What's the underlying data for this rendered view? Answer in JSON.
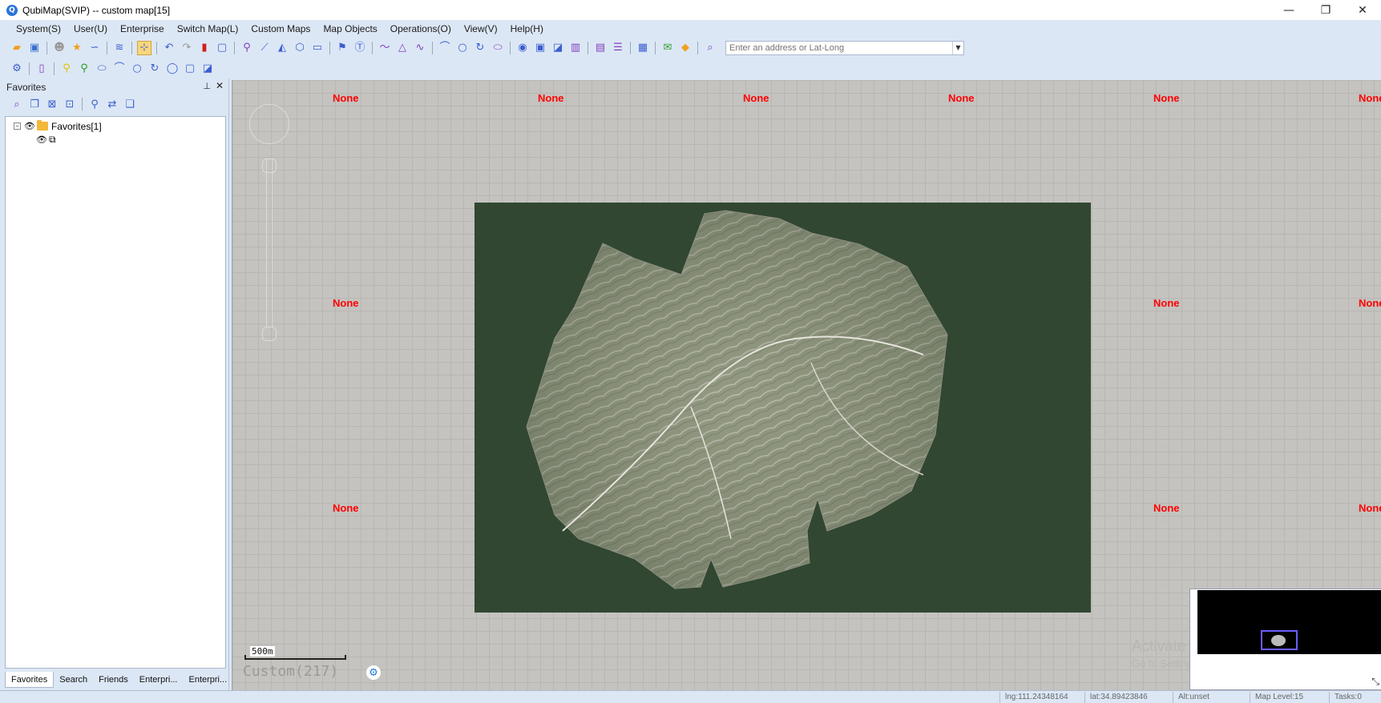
{
  "window": {
    "title": "QubiMap(SVIP) -- custom map[15]",
    "controls": {
      "minimize": "—",
      "restore": "❐",
      "close": "✕"
    }
  },
  "menu": [
    "System(S)",
    "User(U)",
    "Enterprise",
    "Switch Map(L)",
    "Custom Maps",
    "Map Objects",
    "Operations(O)",
    "View(V)",
    "Help(H)"
  ],
  "address": {
    "placeholder": "Enter an address or Lat-Long"
  },
  "left_panel": {
    "title": "Favorites",
    "tree": {
      "root_label": "Favorites[1]"
    },
    "tabs": [
      "Favorites",
      "Search",
      "Friends",
      "Enterpri...",
      "Enterpri..."
    ]
  },
  "map": {
    "tile_label": "None",
    "scale_label": "500m",
    "custom_label": "Custom(217)",
    "watermark": {
      "line1": "Activate Windows",
      "line2": "Go to Settings to activate Windows."
    }
  },
  "status": {
    "lng": "lng:111.24348164",
    "lat": "lat:34.89423846",
    "alt": "Alt:unset",
    "level": "Map Level:15",
    "tasks": "Tasks:0"
  },
  "colors": {
    "accent": "#2a74d8",
    "tile_label": "#ff0000",
    "raster_bg": "#314731",
    "panel_bg": "#dce7f5"
  },
  "icons": {
    "toolbar1": [
      "open-folder-icon",
      "save-icon",
      "user-icon",
      "favorite-star-icon",
      "link-icon",
      "layers-icon",
      "select-tool-icon",
      "undo-icon",
      "redo-icon",
      "delete-icon",
      "rect-select-icon",
      "marker-icon",
      "ruler-icon",
      "measure-area-icon",
      "polygon-tool-icon",
      "video-icon",
      "pin-icon",
      "text-icon",
      "polyline-icon",
      "triangle-icon",
      "curve-icon",
      "arc-icon",
      "circle-icon",
      "rotate-icon",
      "ellipse-icon",
      "circle-solid-icon",
      "square-icon",
      "shape-icon",
      "columns-icon",
      "layout-icon",
      "list-icon",
      "table-icon",
      "chat-icon",
      "diamond-icon",
      "search-icon"
    ],
    "toolbar2": [
      "settings-icon",
      "page-icon",
      "yellow-pin-icon",
      "green-pin-icon",
      "ellipse-icon",
      "arc-icon",
      "circle-icon",
      "rotate-icon",
      "circle-icon",
      "square-icon",
      "shape-icon"
    ]
  }
}
